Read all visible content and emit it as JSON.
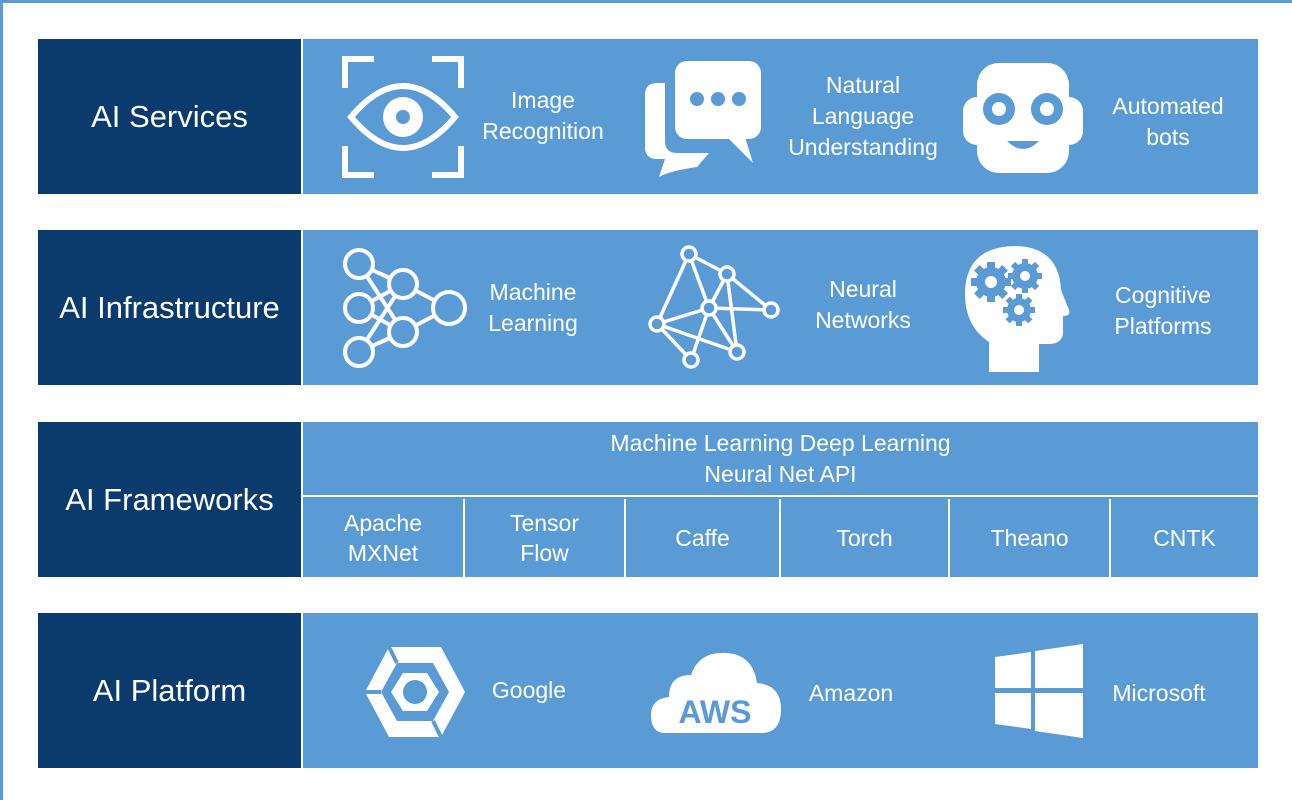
{
  "colors": {
    "dark": "#0b3a6d",
    "light": "#5b9bd5",
    "white": "#ffffff"
  },
  "services": {
    "label": "AI Services",
    "items": [
      {
        "icon": "eye-scan-icon",
        "text": "Image\nRecognition"
      },
      {
        "icon": "chat-bubbles-icon",
        "text": "Natural\nLanguage\nUnderstanding"
      },
      {
        "icon": "robot-face-icon",
        "text": "Automated\nbots"
      }
    ]
  },
  "infrastructure": {
    "label": "AI Infrastructure",
    "items": [
      {
        "icon": "neural-layers-icon",
        "text": "Machine\nLearning"
      },
      {
        "icon": "network-graph-icon",
        "text": "Neural\nNetworks"
      },
      {
        "icon": "head-gears-icon",
        "text": "Cognitive\nPlatforms"
      }
    ]
  },
  "frameworks": {
    "label": "AI Frameworks",
    "header_line1": "Machine Learning Deep Learning",
    "header_line2": "Neural Net API",
    "cells": [
      "Apache\nMXNet",
      "Tensor\nFlow",
      "Caffe",
      "Torch",
      "Theano",
      "CNTK"
    ]
  },
  "platform": {
    "label": "AI Platform",
    "items": [
      {
        "icon": "google-cloud-hexagon-icon",
        "text": "Google"
      },
      {
        "icon": "aws-cloud-icon",
        "text": "Amazon",
        "icon_text": "AWS"
      },
      {
        "icon": "windows-logo-icon",
        "text": "Microsoft"
      }
    ]
  }
}
